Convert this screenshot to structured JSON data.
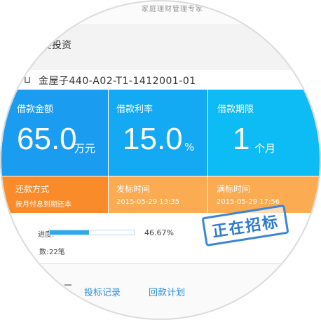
{
  "header": {
    "tagline": "家庭理财管理专家"
  },
  "page": {
    "title": "概要投资"
  },
  "project": {
    "name": "金屋子440-A02-T1-1412001-01"
  },
  "stats": [
    {
      "label": "借款金额",
      "value": "65.0",
      "unit": "万元",
      "color": "#1a9cf0"
    },
    {
      "label": "借款利率",
      "value": "15.0",
      "unit": "%",
      "color": "#14a9f3"
    },
    {
      "label": "借款期限",
      "value": "1",
      "unit": "个月",
      "color": "#0dbbf5"
    }
  ],
  "info": [
    {
      "label": "还款方式",
      "value": "按月付息到期还本",
      "color": "#f98b2b"
    },
    {
      "label": "发标时间",
      "value": "2015-05-29 13:35",
      "color": "#fbab52"
    },
    {
      "label": "满标时间",
      "value": "2015-05-29 17:56",
      "color": "#fbab52"
    }
  ],
  "progress": {
    "label": "进度:",
    "percent_text": "46.67%",
    "percent": 46.67
  },
  "count": {
    "label": "数:",
    "value": "22笔"
  },
  "stamp": {
    "text": "正在招标",
    "color": "#2c7ad3"
  },
  "tabs": [
    {
      "label": "投标记录"
    },
    {
      "label": "回款计划"
    }
  ]
}
